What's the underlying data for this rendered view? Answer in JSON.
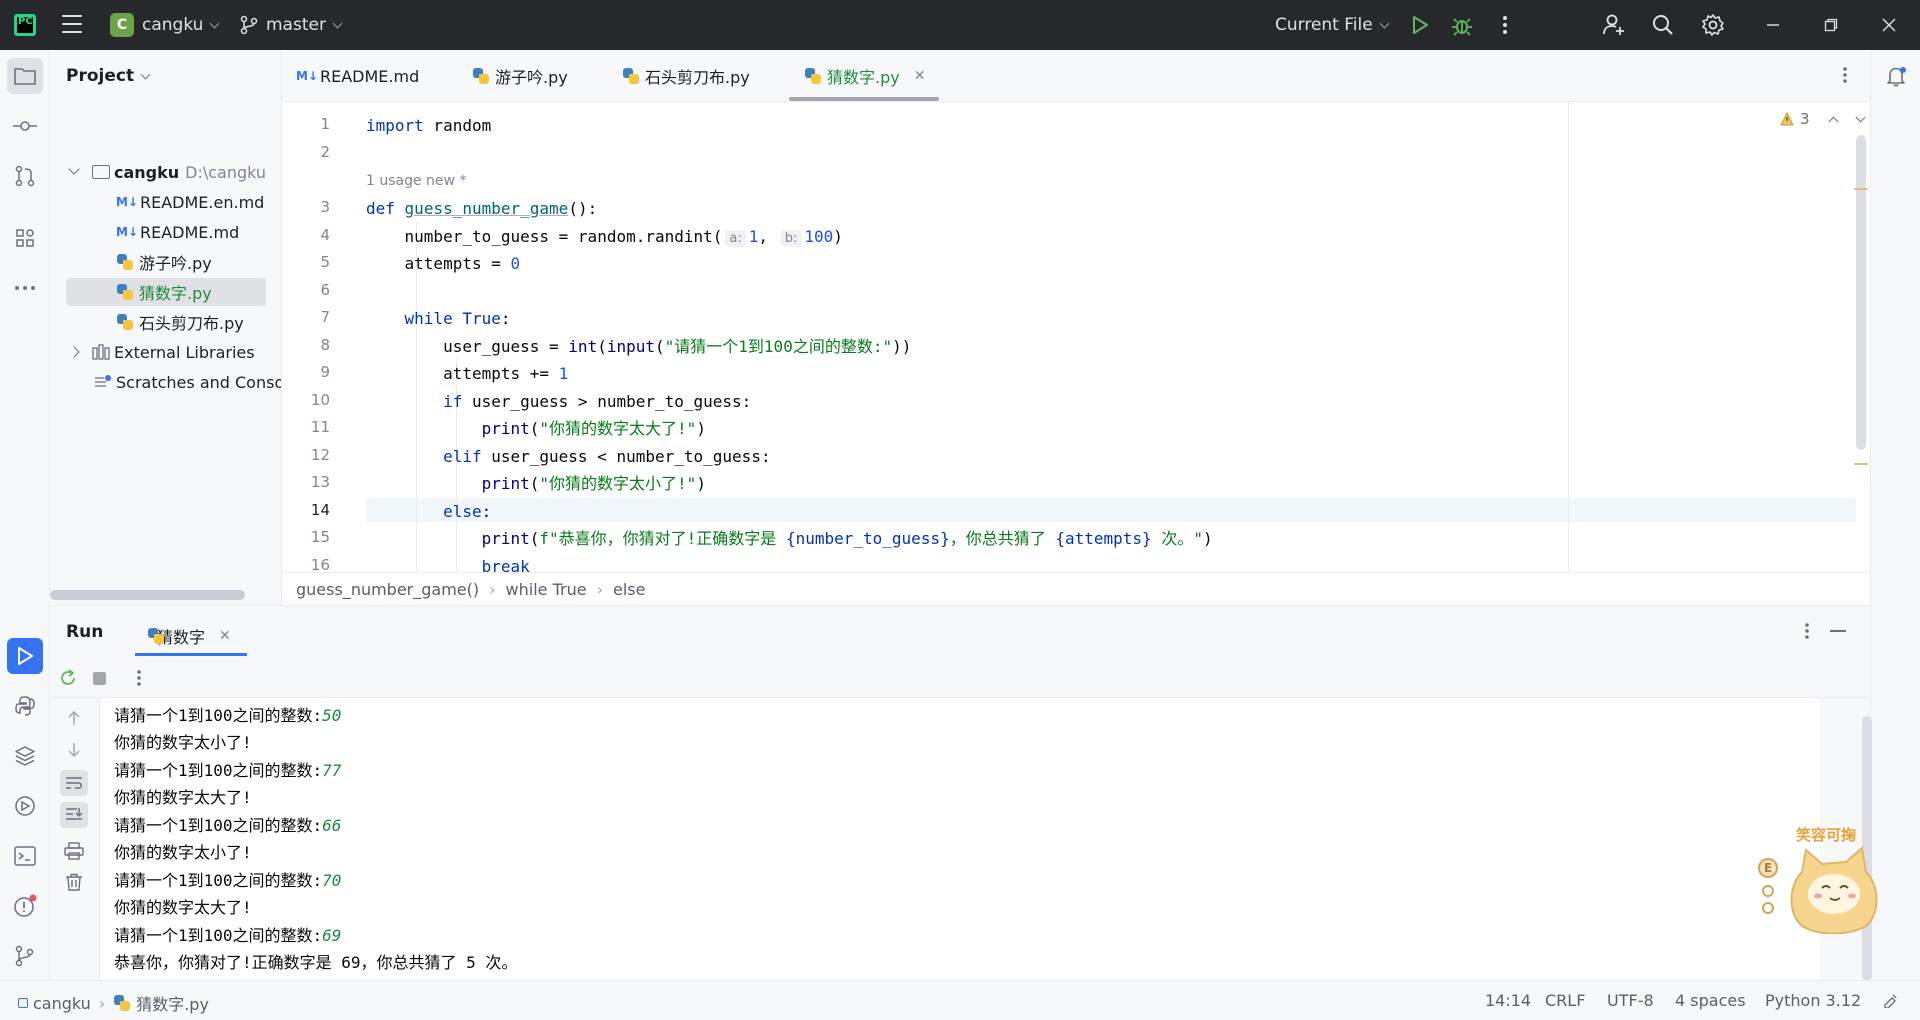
{
  "titlebar": {
    "project_initial": "C",
    "project_name": "cangku",
    "branch": "master",
    "run_config": "Current File"
  },
  "project_panel": {
    "title": "Project",
    "root": {
      "name": "cangku",
      "path": "D:\\cangku"
    },
    "files": [
      {
        "icon": "markdown-icon",
        "name": "README.en.md"
      },
      {
        "icon": "markdown-icon",
        "name": "README.md"
      },
      {
        "icon": "python-icon",
        "name": "游子吟.py"
      },
      {
        "icon": "python-icon",
        "name": "猜数字.py",
        "selected": true
      },
      {
        "icon": "python-icon",
        "name": "石头剪刀布.py"
      }
    ],
    "external_libraries": "External Libraries",
    "scratches": "Scratches and Conso"
  },
  "editor": {
    "tabs": [
      {
        "name": "README.md",
        "icon": "markdown-icon"
      },
      {
        "name": "游子吟.py",
        "icon": "python-icon"
      },
      {
        "name": "石头剪刀布.py",
        "icon": "python-icon"
      },
      {
        "name": "猜数字.py",
        "icon": "python-icon",
        "active": true
      }
    ],
    "inlay_usage": "1 usage   new *",
    "warning_count": "3",
    "line_numbers": [
      "1",
      "2",
      "3",
      "4",
      "5",
      "6",
      "7",
      "8",
      "9",
      "10",
      "11",
      "12",
      "13",
      "14",
      "15",
      "16"
    ],
    "current_line": "14",
    "hint_a": "a:",
    "hint_b": "b:",
    "code": {
      "l1_kw": "import",
      "l1_rest": " random",
      "l3_kw": "def",
      "l3_fn": "guess_number_game",
      "l3_rest": "():",
      "l4_pre": "    number_to_guess = random.randint(",
      "l4_n1": "1",
      "l4_mid": ", ",
      "l4_n2": "100",
      "l4_end": ")",
      "l5_pre": "    attempts = ",
      "l5_n": "0",
      "l7_pre": "    ",
      "l7_kw": "while",
      "l7_sp": " ",
      "l7_kw2": "True",
      "l7_end": ":",
      "l8_pre": "        user_guess = ",
      "l8_bi": "int",
      "l8_p": "(",
      "l8_bi2": "input",
      "l8_p2": "(",
      "l8_str": "\"请猜一个1到100之间的整数:\"",
      "l8_end": "))",
      "l9_pre": "        attempts += ",
      "l9_n": "1",
      "l10_pre": "        ",
      "l10_kw": "if",
      "l10_rest": " user_guess > number_to_guess:",
      "l11_pre": "            ",
      "l11_bi": "print",
      "l11_p": "(",
      "l11_str": "\"你猜的数字太大了!\"",
      "l11_end": ")",
      "l12_pre": "        ",
      "l12_kw": "elif",
      "l12_rest": " user_guess < number_to_guess:",
      "l13_pre": "            ",
      "l13_bi": "print",
      "l13_p": "(",
      "l13_str": "\"你猜的数字太小了!\"",
      "l13_end": ")",
      "l14_pre": "        ",
      "l14_kw": "else",
      "l14_end": ":",
      "l15_pre": "            ",
      "l15_bi": "print",
      "l15_p": "(",
      "l15_s1": "f\"恭喜你，你猜对了!正确数字是 ",
      "l15_v1": "{number_to_guess}",
      "l15_s2": "，你总共猜了 ",
      "l15_v2": "{attempts}",
      "l15_s3": " 次。\"",
      "l15_end": ")",
      "l16_pre": "            ",
      "l16_kw": "break"
    },
    "breadcrumb": [
      "guess_number_game()",
      "while True",
      "else"
    ]
  },
  "run_panel": {
    "title": "Run",
    "tab": "猜数字",
    "console": [
      {
        "prompt": "请猜一个1到100之间的整数:",
        "input": "50"
      },
      {
        "text": "你猜的数字太小了!"
      },
      {
        "prompt": "请猜一个1到100之间的整数:",
        "input": "77"
      },
      {
        "text": "你猜的数字太大了!"
      },
      {
        "prompt": "请猜一个1到100之间的整数:",
        "input": "66"
      },
      {
        "text": "你猜的数字太小了!"
      },
      {
        "prompt": "请猜一个1到100之间的整数:",
        "input": "70"
      },
      {
        "text": "你猜的数字太大了!"
      },
      {
        "prompt": "请猜一个1到100之间的整数:",
        "input": "69"
      },
      {
        "text": "恭喜你，你猜对了!正确数字是 69，你总共猜了 5 次。"
      }
    ]
  },
  "statusbar": {
    "project": "cangku",
    "file": "猜数字.py",
    "position": "14:14",
    "line_ending": "CRLF",
    "encoding": "UTF-8",
    "indent": "4 spaces",
    "interpreter": "Python 3.12"
  },
  "sticker": {
    "text": "笑容可掬",
    "letter": "E"
  },
  "colors": {
    "accent": "#3574f0",
    "string": "#067d17",
    "keyword": "#0033b3",
    "titlebar": "#27282c"
  }
}
